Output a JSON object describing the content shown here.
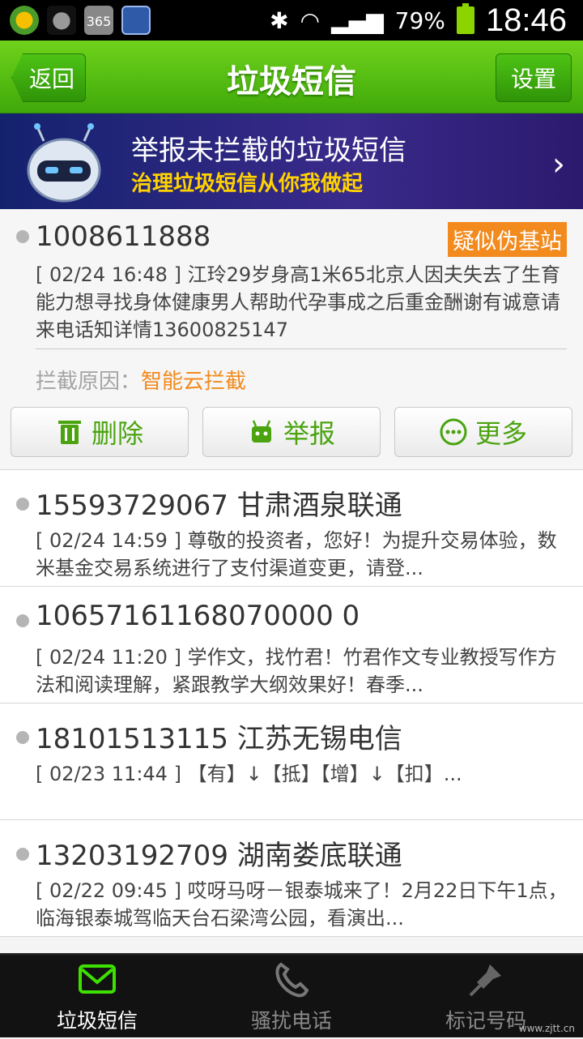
{
  "status": {
    "battery": "79%",
    "time": "18:46"
  },
  "header": {
    "back_label": "返回",
    "title": "垃圾短信",
    "settings_label": "设置"
  },
  "banner": {
    "title": "举报未拦截的垃圾短信",
    "subtitle": "治理垃圾短信从你我做起"
  },
  "expanded": {
    "sender": "1008611888",
    "badge": "疑似伪基站",
    "message": "[ 02/24 16:48 ] 江玲29岁身高1米65北京人因夫失去了生育能力想寻找身体健康男人帮助代孕事成之后重金酬谢有诚意请来电话知详情13600825147",
    "reason_label": "拦截原因：",
    "reason_value": "智能云拦截",
    "actions": {
      "delete": "删除",
      "report": "举报",
      "more": "更多"
    }
  },
  "messages": [
    {
      "sender": "15593729067 甘肃酒泉联通",
      "preview": "[ 02/24 14:59 ] 尊敬的投资者，您好！为提升交易体验，数米基金交易系统进行了支付渠道变更，请登..."
    },
    {
      "sender": "10657161168070000 0",
      "preview": "[ 02/24 11:20 ] 学作文，找竹君！竹君作文专业教授写作方法和阅读理解，紧跟教学大纲效果好！春季..."
    },
    {
      "sender": "18101513115 江苏无锡电信",
      "preview": "[ 02/23 11:44 ] 【有】↓【抵】【增】↓【扣】..."
    },
    {
      "sender": "13203192709 湖南娄底联通",
      "preview": "[ 02/22 09:45 ] 哎呀马呀－银泰城来了！2月22日下午1点，临海银泰城驾临天台石梁湾公园，看演出..."
    }
  ],
  "tabs": [
    {
      "label": "垃圾短信",
      "icon": "envelope-icon"
    },
    {
      "label": "骚扰电话",
      "icon": "phone-icon"
    },
    {
      "label": "标记号码",
      "icon": "pin-icon"
    }
  ],
  "watermark": "www.zjtt.cn",
  "colors": {
    "accent": "#4aa30f",
    "badge": "#f28a1d",
    "title_bar": "#3fa90a"
  }
}
